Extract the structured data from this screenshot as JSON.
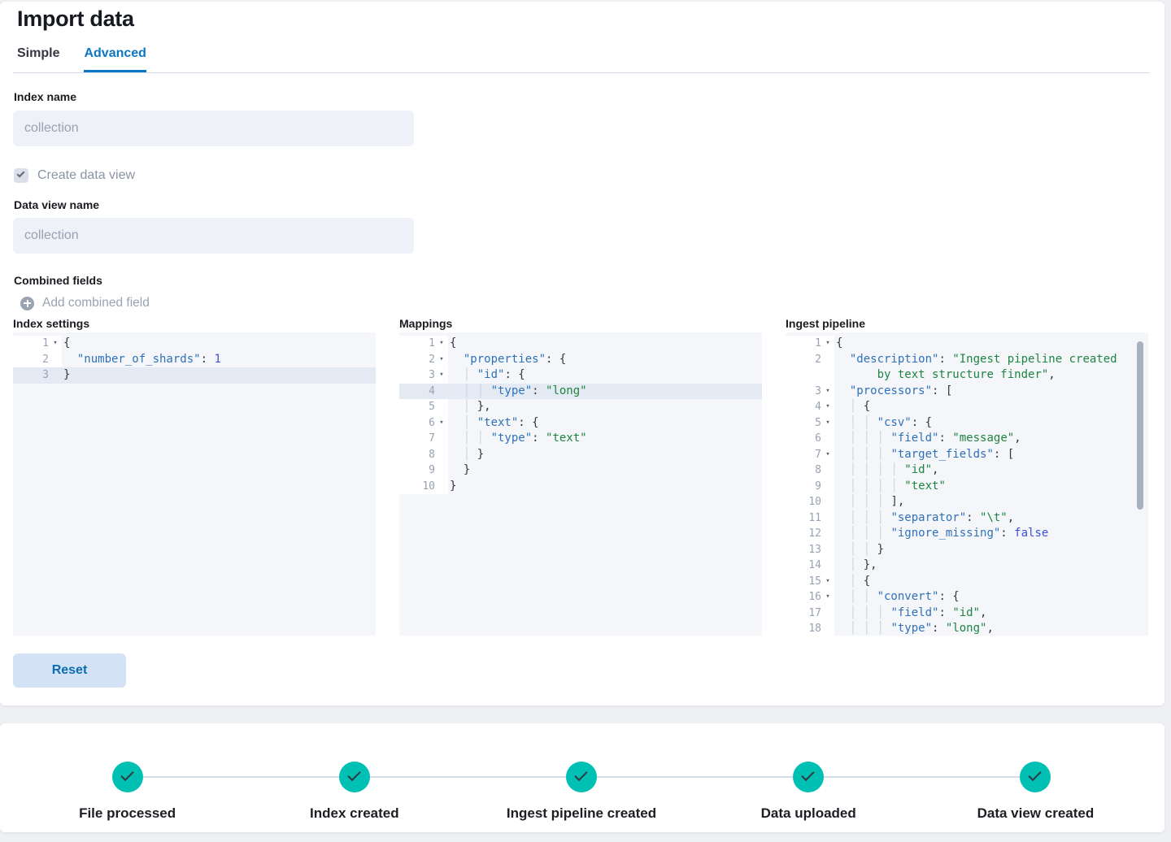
{
  "page": {
    "title": "Import data"
  },
  "tabs": [
    {
      "label": "Simple",
      "active": false
    },
    {
      "label": "Advanced",
      "active": true
    }
  ],
  "form": {
    "index_name": {
      "label": "Index name",
      "value": "",
      "placeholder": "collection"
    },
    "create_data_view": {
      "label": "Create data view",
      "checked": true
    },
    "data_view_name": {
      "label": "Data view name",
      "value": "",
      "placeholder": "collection"
    },
    "combined_fields": {
      "label": "Combined fields",
      "add_label": "Add combined field",
      "add_icon": "plus-circle-icon"
    }
  },
  "editors": [
    {
      "title": "Index settings",
      "scrollbar": false,
      "lines": [
        {
          "n": "1",
          "f": true,
          "a": false,
          "seg": [
            [
              "{",
              "p"
            ]
          ]
        },
        {
          "n": "2",
          "f": false,
          "a": false,
          "seg": [
            [
              "  ",
              "p"
            ],
            [
              "\"number_of_shards\"",
              "k"
            ],
            [
              ": ",
              "p"
            ],
            [
              "1",
              "c"
            ]
          ]
        },
        {
          "n": "3",
          "f": false,
          "a": true,
          "seg": [
            [
              "}",
              "p"
            ]
          ]
        }
      ]
    },
    {
      "title": "Mappings",
      "scrollbar": false,
      "lines": [
        {
          "n": "1",
          "f": true,
          "a": false,
          "seg": [
            [
              "{",
              "p"
            ]
          ]
        },
        {
          "n": "2",
          "f": true,
          "a": false,
          "seg": [
            [
              "  ",
              "p"
            ],
            [
              "\"properties\"",
              "k"
            ],
            [
              ": ",
              "p"
            ],
            [
              "{",
              "p"
            ]
          ]
        },
        {
          "n": "3",
          "f": true,
          "a": false,
          "seg": [
            [
              "  ",
              "p"
            ],
            [
              "│ ",
              "g"
            ],
            [
              "\"id\"",
              "k"
            ],
            [
              ": ",
              "p"
            ],
            [
              "{",
              "p"
            ]
          ]
        },
        {
          "n": "4",
          "f": false,
          "a": true,
          "seg": [
            [
              "  ",
              "p"
            ],
            [
              "│ ",
              "g"
            ],
            [
              "│ ",
              "g"
            ],
            [
              "\"type\"",
              "k"
            ],
            [
              ": ",
              "p"
            ],
            [
              "\"long\"",
              "s"
            ]
          ]
        },
        {
          "n": "5",
          "f": false,
          "a": false,
          "seg": [
            [
              "  ",
              "p"
            ],
            [
              "│ ",
              "g"
            ],
            [
              "},",
              "p"
            ]
          ]
        },
        {
          "n": "6",
          "f": true,
          "a": false,
          "seg": [
            [
              "  ",
              "p"
            ],
            [
              "│ ",
              "g"
            ],
            [
              "\"text\"",
              "k"
            ],
            [
              ": ",
              "p"
            ],
            [
              "{",
              "p"
            ]
          ]
        },
        {
          "n": "7",
          "f": false,
          "a": false,
          "seg": [
            [
              "  ",
              "p"
            ],
            [
              "│ ",
              "g"
            ],
            [
              "│ ",
              "g"
            ],
            [
              "\"type\"",
              "k"
            ],
            [
              ": ",
              "p"
            ],
            [
              "\"text\"",
              "s"
            ]
          ]
        },
        {
          "n": "8",
          "f": false,
          "a": false,
          "seg": [
            [
              "  ",
              "p"
            ],
            [
              "│ ",
              "g"
            ],
            [
              "}",
              "p"
            ]
          ]
        },
        {
          "n": "9",
          "f": false,
          "a": false,
          "seg": [
            [
              "  ",
              "p"
            ],
            [
              "}",
              "p"
            ]
          ]
        },
        {
          "n": "10",
          "f": false,
          "a": false,
          "seg": [
            [
              "}",
              "p"
            ]
          ]
        }
      ]
    },
    {
      "title": "Ingest pipeline",
      "scrollbar": true,
      "lines": [
        {
          "n": "1",
          "f": true,
          "a": false,
          "seg": [
            [
              "{",
              "p"
            ]
          ]
        },
        {
          "n": "2",
          "f": false,
          "a": false,
          "seg": [
            [
              "  ",
              "p"
            ],
            [
              "\"description\"",
              "k"
            ],
            [
              ": ",
              "p"
            ],
            [
              "\"Ingest pipeline created",
              "s"
            ]
          ]
        },
        {
          "n": "",
          "f": false,
          "a": false,
          "seg": [
            [
              "      ",
              "p"
            ],
            [
              "by text structure finder\"",
              "s"
            ],
            [
              ",",
              "p"
            ]
          ]
        },
        {
          "n": "3",
          "f": true,
          "a": false,
          "seg": [
            [
              "  ",
              "p"
            ],
            [
              "\"processors\"",
              "k"
            ],
            [
              ": ",
              "p"
            ],
            [
              "[",
              "p"
            ]
          ]
        },
        {
          "n": "4",
          "f": true,
          "a": false,
          "seg": [
            [
              "  ",
              "p"
            ],
            [
              "│ ",
              "g"
            ],
            [
              "{",
              "p"
            ]
          ]
        },
        {
          "n": "5",
          "f": true,
          "a": false,
          "seg": [
            [
              "  ",
              "p"
            ],
            [
              "│ ",
              "g"
            ],
            [
              "│ ",
              "g"
            ],
            [
              "\"csv\"",
              "k"
            ],
            [
              ": ",
              "p"
            ],
            [
              "{",
              "p"
            ]
          ]
        },
        {
          "n": "6",
          "f": false,
          "a": false,
          "seg": [
            [
              "  ",
              "p"
            ],
            [
              "│ ",
              "g"
            ],
            [
              "│ ",
              "g"
            ],
            [
              "│ ",
              "g"
            ],
            [
              "\"field\"",
              "k"
            ],
            [
              ": ",
              "p"
            ],
            [
              "\"message\"",
              "s"
            ],
            [
              ",",
              "p"
            ]
          ]
        },
        {
          "n": "7",
          "f": true,
          "a": false,
          "seg": [
            [
              "  ",
              "p"
            ],
            [
              "│ ",
              "g"
            ],
            [
              "│ ",
              "g"
            ],
            [
              "│ ",
              "g"
            ],
            [
              "\"target_fields\"",
              "k"
            ],
            [
              ": ",
              "p"
            ],
            [
              "[",
              "p"
            ]
          ]
        },
        {
          "n": "8",
          "f": false,
          "a": false,
          "seg": [
            [
              "  ",
              "p"
            ],
            [
              "│ ",
              "g"
            ],
            [
              "│ ",
              "g"
            ],
            [
              "│ ",
              "g"
            ],
            [
              "│ ",
              "g"
            ],
            [
              "\"id\"",
              "s"
            ],
            [
              ",",
              "p"
            ]
          ]
        },
        {
          "n": "9",
          "f": false,
          "a": false,
          "seg": [
            [
              "  ",
              "p"
            ],
            [
              "│ ",
              "g"
            ],
            [
              "│ ",
              "g"
            ],
            [
              "│ ",
              "g"
            ],
            [
              "│ ",
              "g"
            ],
            [
              "\"text\"",
              "s"
            ]
          ]
        },
        {
          "n": "10",
          "f": false,
          "a": false,
          "seg": [
            [
              "  ",
              "p"
            ],
            [
              "│ ",
              "g"
            ],
            [
              "│ ",
              "g"
            ],
            [
              "│ ",
              "g"
            ],
            [
              "],",
              "p"
            ]
          ]
        },
        {
          "n": "11",
          "f": false,
          "a": false,
          "seg": [
            [
              "  ",
              "p"
            ],
            [
              "│ ",
              "g"
            ],
            [
              "│ ",
              "g"
            ],
            [
              "│ ",
              "g"
            ],
            [
              "\"separator\"",
              "k"
            ],
            [
              ": ",
              "p"
            ],
            [
              "\"\\t\"",
              "s"
            ],
            [
              ",",
              "p"
            ]
          ]
        },
        {
          "n": "12",
          "f": false,
          "a": false,
          "seg": [
            [
              "  ",
              "p"
            ],
            [
              "│ ",
              "g"
            ],
            [
              "│ ",
              "g"
            ],
            [
              "│ ",
              "g"
            ],
            [
              "\"ignore_missing\"",
              "k"
            ],
            [
              ": ",
              "p"
            ],
            [
              "false",
              "c"
            ]
          ]
        },
        {
          "n": "13",
          "f": false,
          "a": false,
          "seg": [
            [
              "  ",
              "p"
            ],
            [
              "│ ",
              "g"
            ],
            [
              "│ ",
              "g"
            ],
            [
              "}",
              "p"
            ]
          ]
        },
        {
          "n": "14",
          "f": false,
          "a": false,
          "seg": [
            [
              "  ",
              "p"
            ],
            [
              "│ ",
              "g"
            ],
            [
              "},",
              "p"
            ]
          ]
        },
        {
          "n": "15",
          "f": true,
          "a": false,
          "seg": [
            [
              "  ",
              "p"
            ],
            [
              "│ ",
              "g"
            ],
            [
              "{",
              "p"
            ]
          ]
        },
        {
          "n": "16",
          "f": true,
          "a": false,
          "seg": [
            [
              "  ",
              "p"
            ],
            [
              "│ ",
              "g"
            ],
            [
              "│ ",
              "g"
            ],
            [
              "\"convert\"",
              "k"
            ],
            [
              ": ",
              "p"
            ],
            [
              "{",
              "p"
            ]
          ]
        },
        {
          "n": "17",
          "f": false,
          "a": false,
          "seg": [
            [
              "  ",
              "p"
            ],
            [
              "│ ",
              "g"
            ],
            [
              "│ ",
              "g"
            ],
            [
              "│ ",
              "g"
            ],
            [
              "\"field\"",
              "k"
            ],
            [
              ": ",
              "p"
            ],
            [
              "\"id\"",
              "s"
            ],
            [
              ",",
              "p"
            ]
          ]
        },
        {
          "n": "18",
          "f": false,
          "a": false,
          "seg": [
            [
              "  ",
              "p"
            ],
            [
              "│ ",
              "g"
            ],
            [
              "│ ",
              "g"
            ],
            [
              "│ ",
              "g"
            ],
            [
              "\"type\"",
              "k"
            ],
            [
              ": ",
              "p"
            ],
            [
              "\"long\"",
              "s"
            ],
            [
              ",",
              "p"
            ]
          ]
        }
      ]
    }
  ],
  "toolbar": {
    "reset_label": "Reset"
  },
  "progress": {
    "steps": [
      {
        "label": "File processed",
        "status": "complete"
      },
      {
        "label": "Index created",
        "status": "complete"
      },
      {
        "label": "Ingest pipeline created",
        "status": "complete"
      },
      {
        "label": "Data uploaded",
        "status": "complete"
      },
      {
        "label": "Data view created",
        "status": "complete"
      }
    ]
  },
  "colors": {
    "accent_blue": "#0b76c3",
    "success_teal": "#00BFB3",
    "json_key": "#2e71b8",
    "json_string": "#1e8540",
    "json_constant": "#3b4fd8",
    "editor_background": "#f4f6fa",
    "active_line": "#e4eaf3",
    "reset_button_background": "#d3e3f5"
  }
}
